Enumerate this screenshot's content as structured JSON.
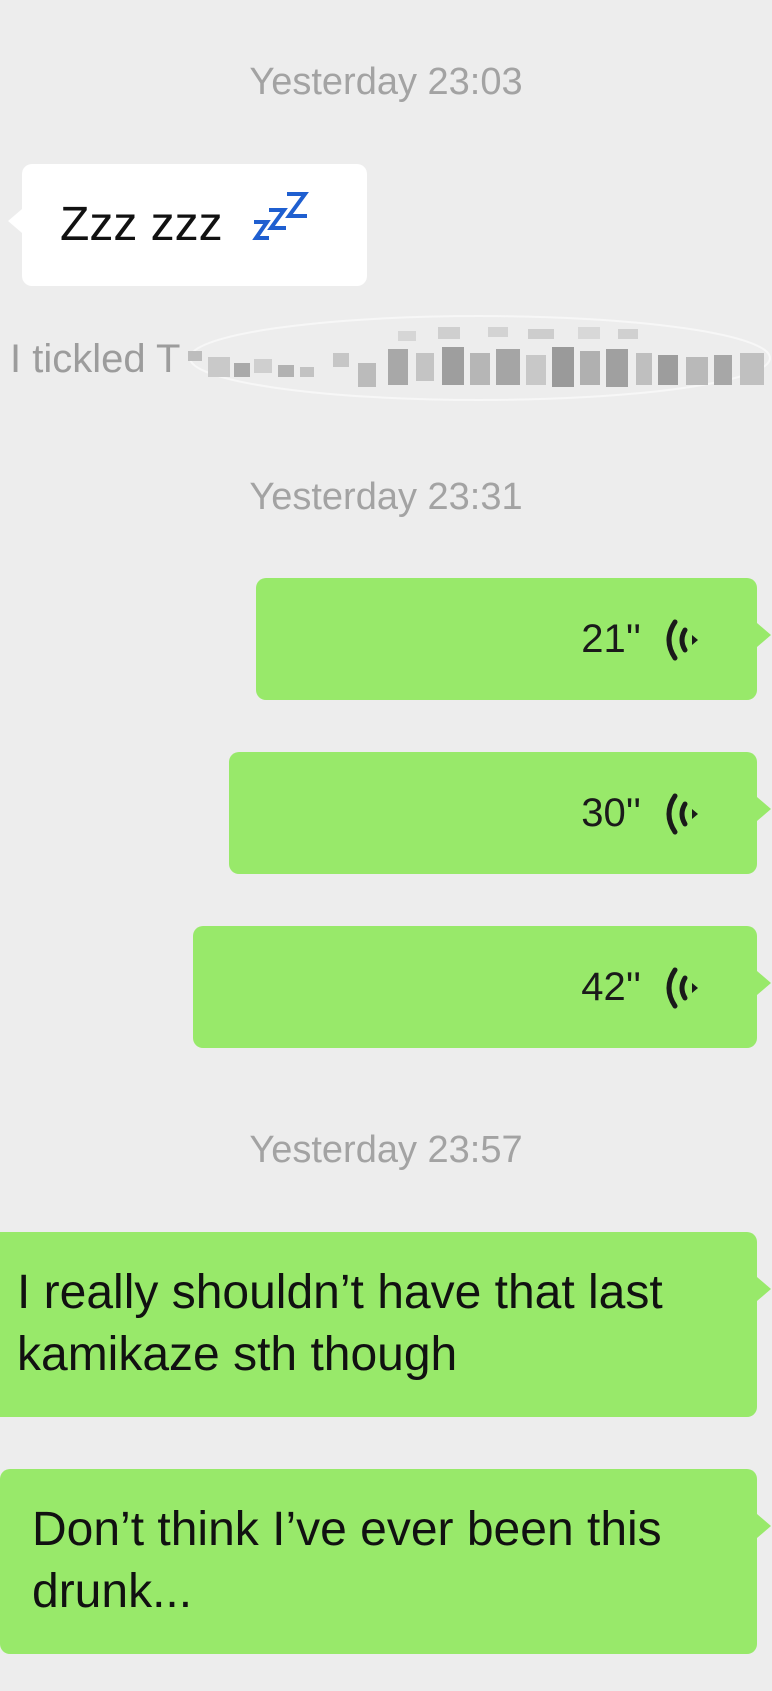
{
  "messages": [
    {
      "type": "timestamp",
      "text": "Yesterday 23:03"
    },
    {
      "type": "incoming_text",
      "text": "Zzz zzz",
      "icon": "sleeping-zzz-icon"
    },
    {
      "type": "system",
      "text": "I  tickled T",
      "note": "pixelated"
    },
    {
      "type": "timestamp",
      "text": "Yesterday 23:31"
    },
    {
      "type": "outgoing_voice",
      "duration": "21''",
      "icon": "voice-wave-icon"
    },
    {
      "type": "outgoing_voice",
      "duration": "30''",
      "icon": "voice-wave-icon"
    },
    {
      "type": "outgoing_voice",
      "duration": "42''",
      "icon": "voice-wave-icon"
    },
    {
      "type": "timestamp",
      "text": "Yesterday 23:57"
    },
    {
      "type": "outgoing_text",
      "text": "I really shouldn’t have that last kamikaze sth though"
    },
    {
      "type": "outgoing_text",
      "text": "Don’t think I’ve ever been this drunk..."
    }
  ],
  "colors": {
    "background": "#ededed",
    "incoming_bubble": "#ffffff",
    "outgoing_bubble": "#98e96a",
    "timestamp_text": "#a3a3a3",
    "zzz_icon": "#1f5fd0"
  }
}
